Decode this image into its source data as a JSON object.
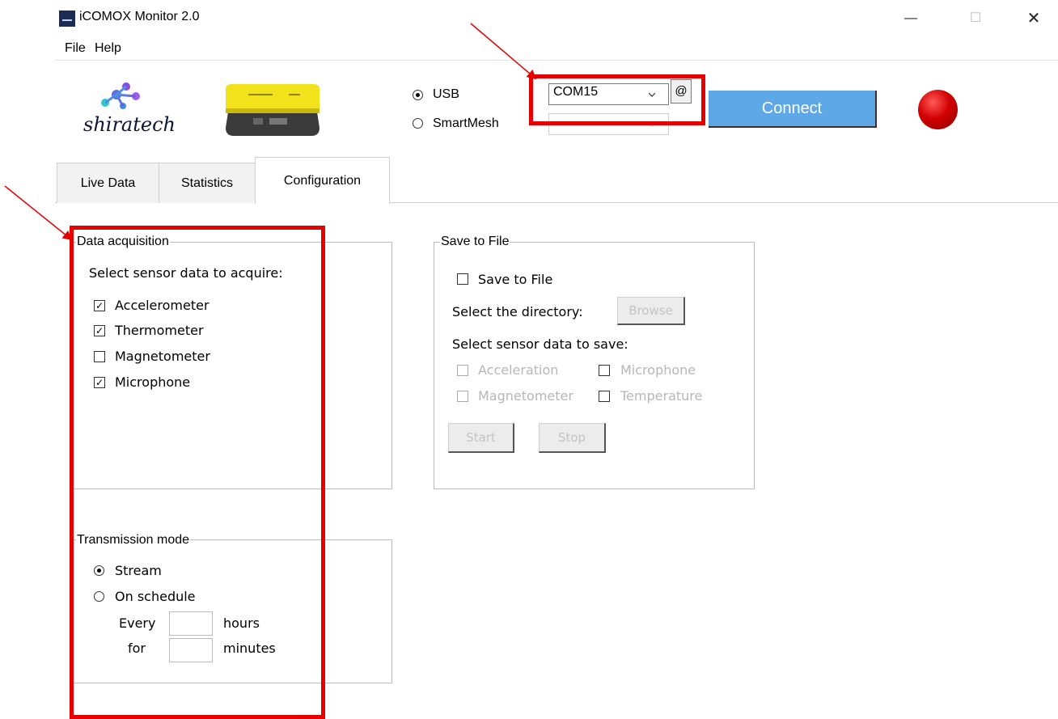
{
  "window": {
    "title": "iCOMOX Monitor 2.0",
    "controls": {
      "minimize": "—",
      "maximize": "☐",
      "close": "✕"
    }
  },
  "menu": {
    "file": "File",
    "help": "Help"
  },
  "header": {
    "logo_text": "shiratech",
    "connection": {
      "usb_label": "USB",
      "smartmesh_label": "SmartMesh",
      "selected": "USB",
      "com_port": "COM15",
      "at_button": "@",
      "connect_label": "Connect",
      "status_color": "#d10000"
    }
  },
  "tabs": [
    {
      "label": "Live Data",
      "active": false
    },
    {
      "label": "Statistics",
      "active": false
    },
    {
      "label": "Configuration",
      "active": true
    }
  ],
  "data_acquisition": {
    "title": "Data acquisition",
    "prompt": "Select sensor data to acquire:",
    "sensors": [
      {
        "label": "Accelerometer",
        "checked": true,
        "mark": "✓"
      },
      {
        "label": "Thermometer",
        "checked": true,
        "mark": "✓"
      },
      {
        "label": "Magnetometer",
        "checked": false,
        "mark": ""
      },
      {
        "label": "Microphone",
        "checked": true,
        "mark": "✓"
      }
    ]
  },
  "transmission_mode": {
    "title": "Transmission mode",
    "stream_label": "Stream",
    "schedule_label": "On schedule",
    "selected": "Stream",
    "every_label": "Every",
    "hours_label": "hours",
    "for_label": "for",
    "minutes_label": "minutes",
    "hours_value": "",
    "minutes_value": ""
  },
  "save_to_file": {
    "title": "Save to File",
    "checkbox_label": "Save to File",
    "directory_label": "Select the directory:",
    "browse_label": "Browse",
    "prompt": "Select sensor data to save:",
    "options": [
      "Acceleration",
      "Microphone",
      "Magnetometer",
      "Temperature"
    ],
    "start_label": "Start",
    "stop_label": "Stop"
  },
  "colors": {
    "annotation_red": "#e60000",
    "connect_blue": "#5fa8e8"
  }
}
